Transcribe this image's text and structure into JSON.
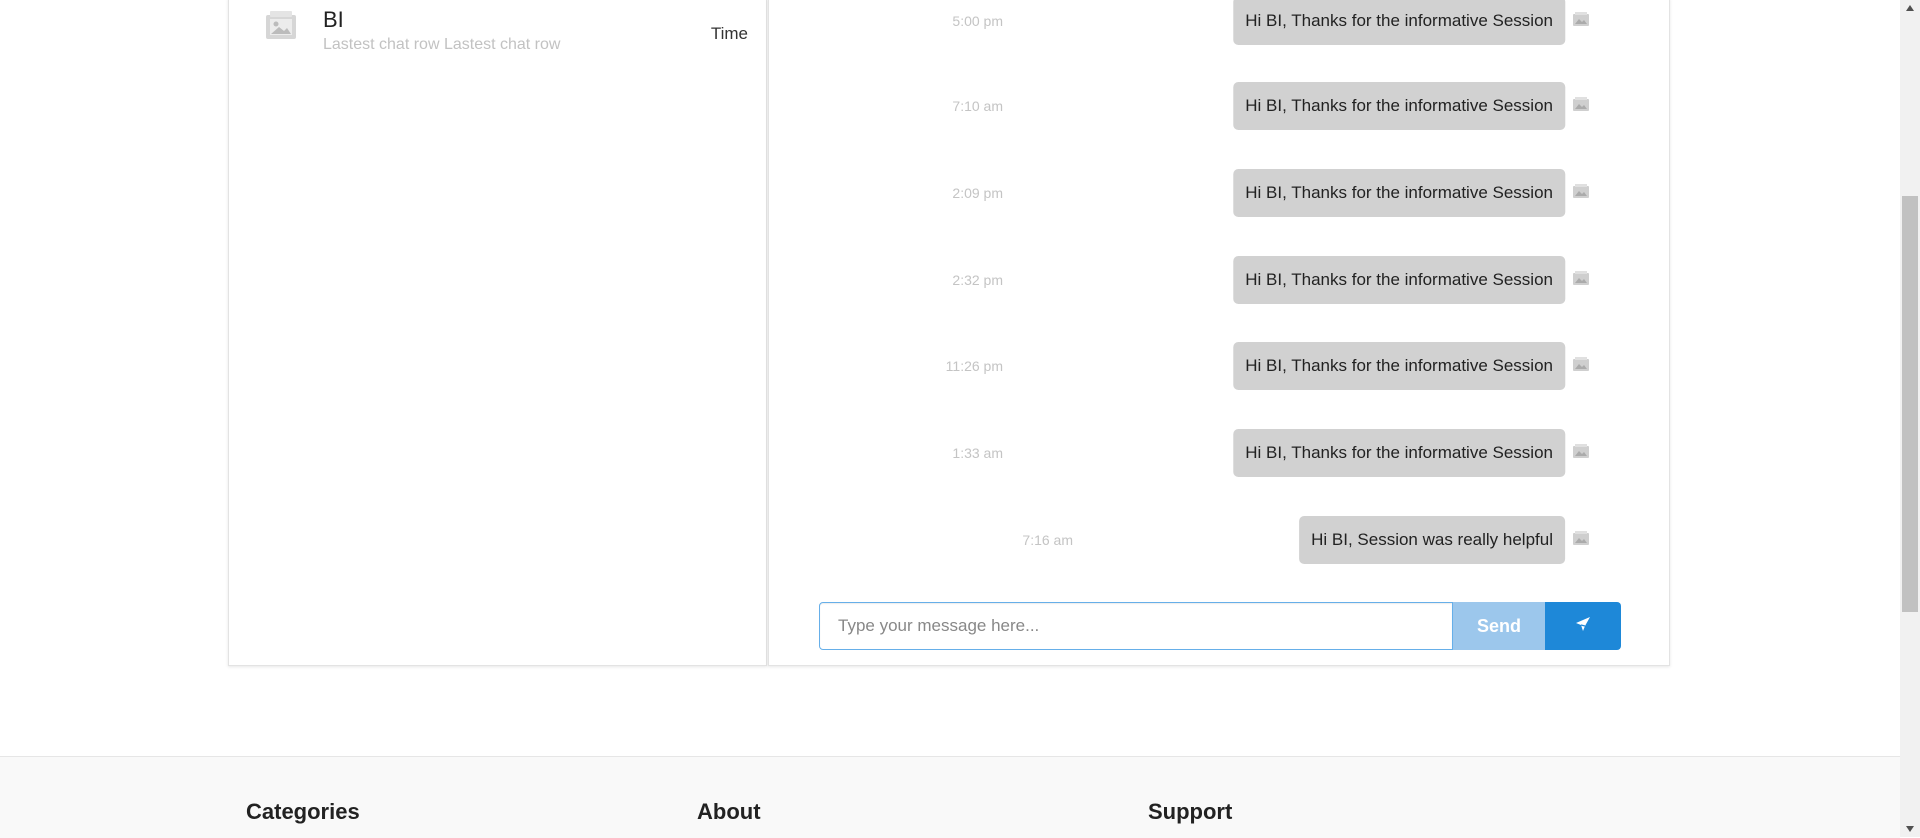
{
  "chat_list": {
    "items": [
      {
        "name": "BI",
        "preview": "Lastest chat row Lastest chat row",
        "time": "Time"
      }
    ]
  },
  "messages": [
    {
      "time": "5:00 pm",
      "text": "Hi BI, Thanks for the informative Session"
    },
    {
      "time": "7:10 am",
      "text": "Hi BI, Thanks for the informative Session"
    },
    {
      "time": "2:09 pm",
      "text": "Hi BI, Thanks for the informative Session"
    },
    {
      "time": "2:32 pm",
      "text": "Hi BI, Thanks for the informative Session"
    },
    {
      "time": "11:26 pm",
      "text": "Hi BI, Thanks for the informative Session"
    },
    {
      "time": "1:33 am",
      "text": "Hi BI, Thanks for the informative Session"
    },
    {
      "time": "7:16 am",
      "text": "Hi BI, Session was really helpful"
    }
  ],
  "compose": {
    "placeholder": "Type your message here...",
    "send_label": "Send",
    "send_icon": "plane-icon"
  },
  "footer": {
    "headings": [
      "Categories",
      "About",
      "Support"
    ]
  },
  "colors": {
    "bubble": "#d1d1d1",
    "send_button": "#9cc7ec",
    "plane_button": "#1e88d8",
    "input_border": "#66afe9"
  }
}
